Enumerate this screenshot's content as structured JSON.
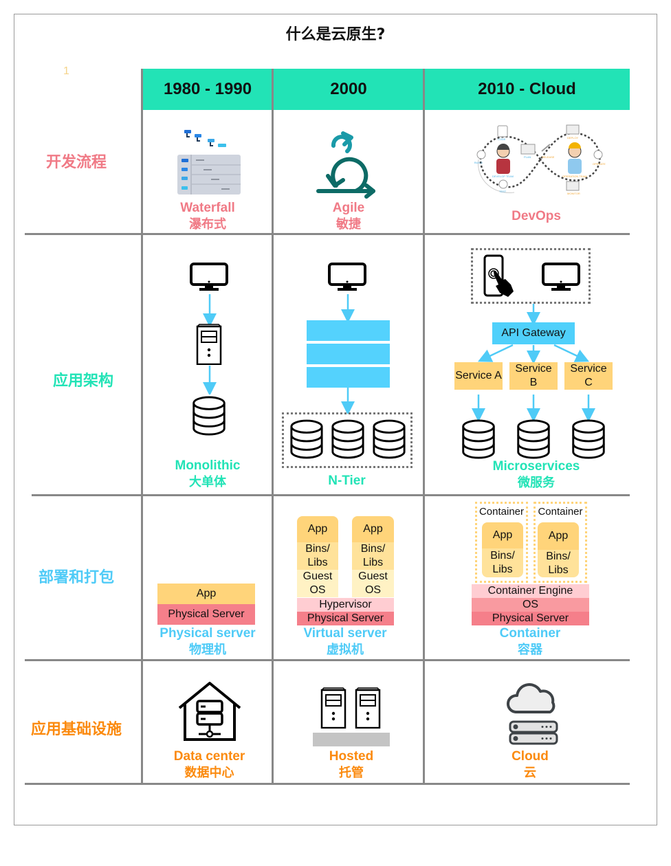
{
  "title": "什么是云原生?",
  "marker": "1",
  "colors": {
    "header_bg": "#22e3b6",
    "dev_process": "#f07a86",
    "architecture": "#22e3b6",
    "deployment": "#4fcbf7",
    "infrastructure": "#fb8a0e",
    "app_layer": "#ffd47a",
    "physical_server": "#f57f8a"
  },
  "columns": [
    "1980 - 1990",
    "2000",
    "2010 - Cloud"
  ],
  "rows": [
    {
      "label": "开发流程",
      "cells": [
        {
          "icon": "waterfall-icon",
          "en": "Waterfall",
          "zh": "瀑布式"
        },
        {
          "icon": "agile-cycle-icon",
          "en": "Agile",
          "zh": "敏捷"
        },
        {
          "icon": "devops-infinity-icon",
          "en": "DevOps",
          "zh": "",
          "diagram_labels": [
            "CODE",
            "PLAN",
            "BUILD",
            "DEVELOP TEAM",
            "TEST",
            "RELEASE",
            "DEPLOY",
            "OPERATE",
            "OPERATION TEAM",
            "MONITOR"
          ]
        }
      ]
    },
    {
      "label": "应用架构",
      "cells": [
        {
          "en": "Monolithic",
          "zh": "大单体"
        },
        {
          "en": "N-Tier",
          "zh": ""
        },
        {
          "en": "Microservices",
          "zh": "微服务",
          "gateway": "API Gateway",
          "services": [
            "Service A",
            "Service\nB",
            "Service\nC"
          ]
        }
      ]
    },
    {
      "label": "部署和打包",
      "cells": [
        {
          "en": "Physical server",
          "zh": "物理机",
          "layers": [
            "App",
            "Physical Server"
          ]
        },
        {
          "en": "Virtual server",
          "zh": "虚拟机",
          "vm": {
            "app": "App",
            "bins": "Bins/\nLibs",
            "guest": "Guest\nOS"
          },
          "layers": [
            "Hypervisor",
            "Physical Server"
          ]
        },
        {
          "en": "Container",
          "zh": "容器",
          "container": {
            "label": "Container",
            "app": "App",
            "bins": "Bins/\nLibs"
          },
          "layers": [
            "Container Engine",
            "OS",
            "Physical Server"
          ]
        }
      ]
    },
    {
      "label": "应用基础设施",
      "cells": [
        {
          "icon": "datacenter-house-icon",
          "en": "Data center",
          "zh": "数据中心"
        },
        {
          "icon": "hosted-servers-icon",
          "en": "Hosted",
          "zh": "托管"
        },
        {
          "icon": "cloud-server-icon",
          "en": "Cloud",
          "zh": "云"
        }
      ]
    }
  ]
}
